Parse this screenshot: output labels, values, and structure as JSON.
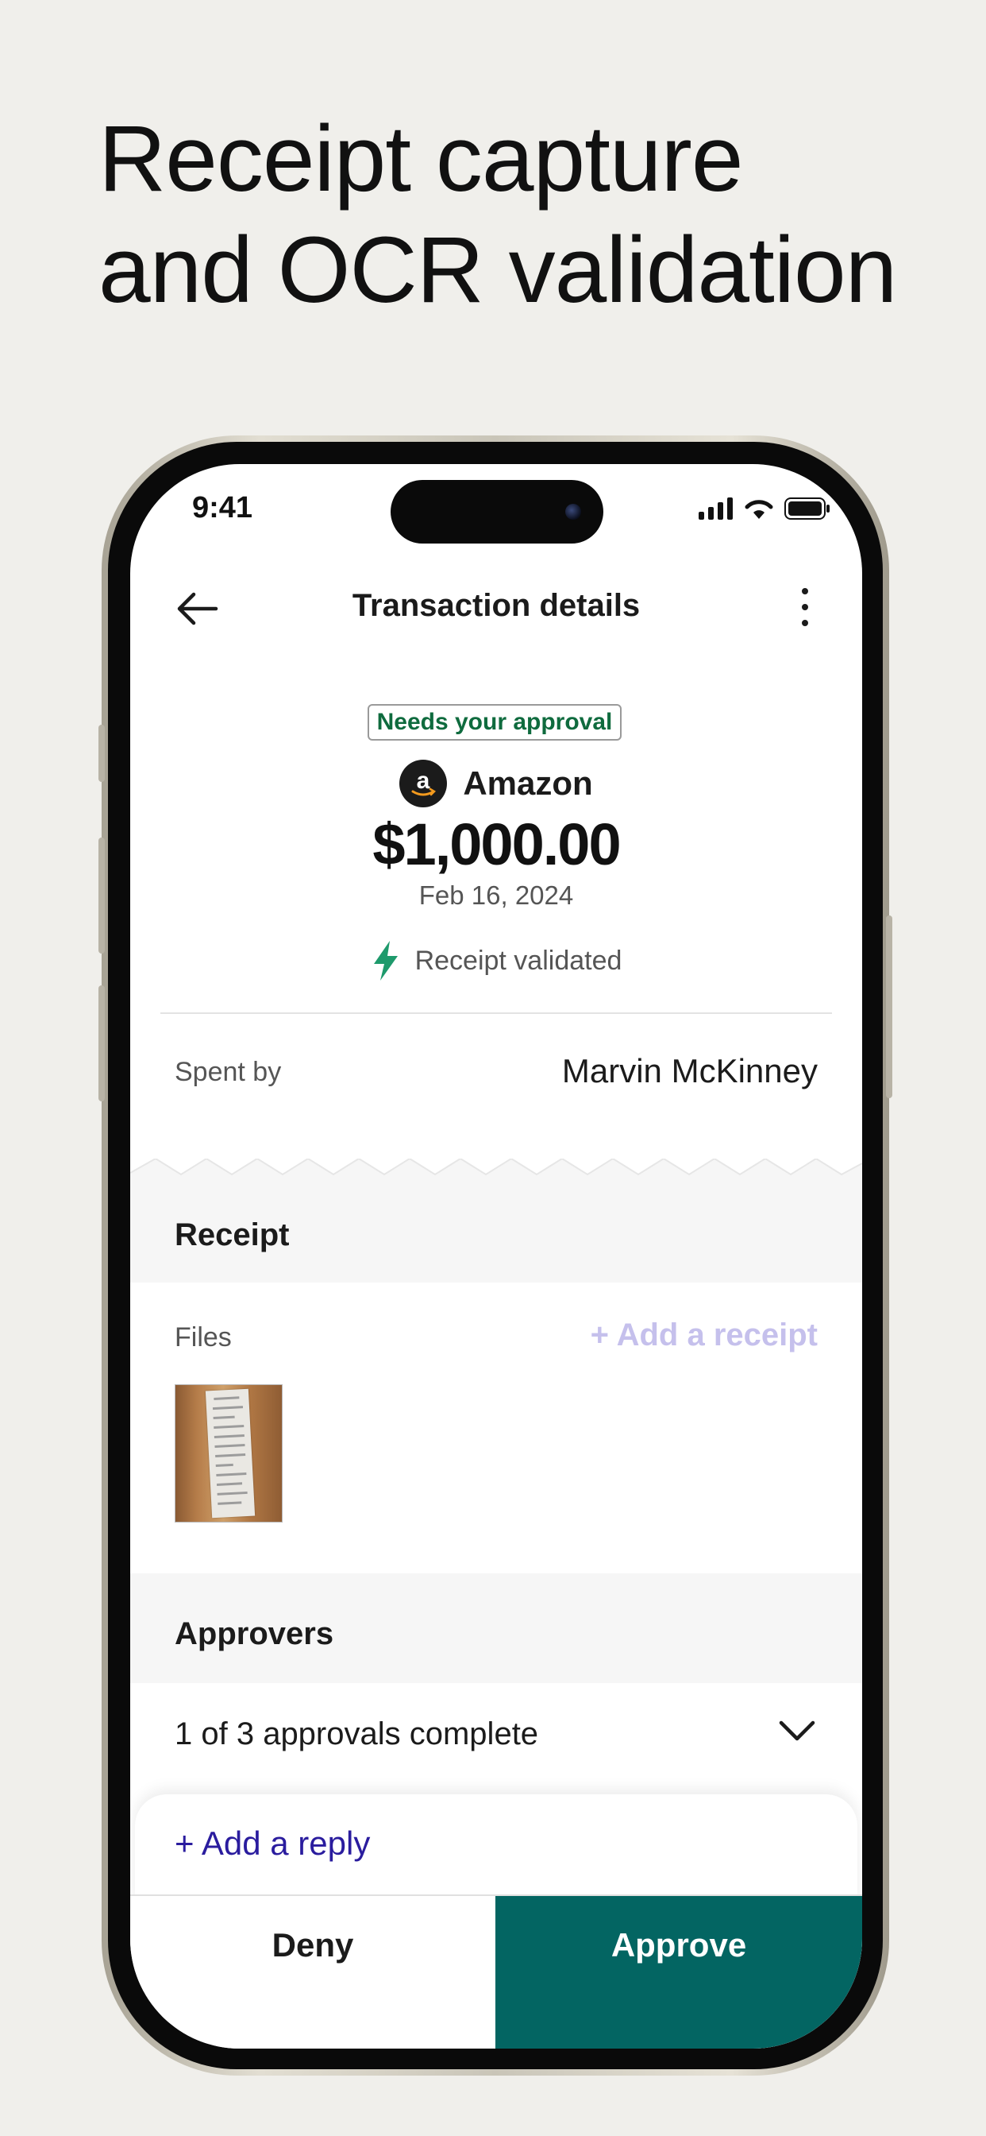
{
  "headline": {
    "line1": "Receipt capture",
    "line2": "and OCR validation"
  },
  "status_bar": {
    "time": "9:41",
    "icons": [
      "signal-icon",
      "wifi-icon",
      "battery-icon"
    ]
  },
  "nav": {
    "title": "Transaction details",
    "back_icon": "arrow-left-icon",
    "more_icon": "more-vertical-icon"
  },
  "transaction": {
    "badge": "Needs your approval",
    "merchant": "Amazon",
    "amount": "$1,000.00",
    "date": "Feb 16, 2024",
    "validation": "Receipt validated"
  },
  "spent_by": {
    "label": "Spent by",
    "value": "Marvin McKinney"
  },
  "receipt": {
    "title": "Receipt",
    "files_label": "Files",
    "add_label": "+ Add a receipt"
  },
  "approvers": {
    "title": "Approvers",
    "status": "1 of 3 approvals complete"
  },
  "reply": {
    "label": "+ Add a reply"
  },
  "actions": {
    "deny": "Deny",
    "approve": "Approve"
  },
  "colors": {
    "background": "#f0efeb",
    "badge_text": "#0f6b3e",
    "bolt": "#1e9a6c",
    "add_receipt": "#c5c0ec",
    "reply_link": "#2a1c9e",
    "approve_bg": "#036562"
  }
}
